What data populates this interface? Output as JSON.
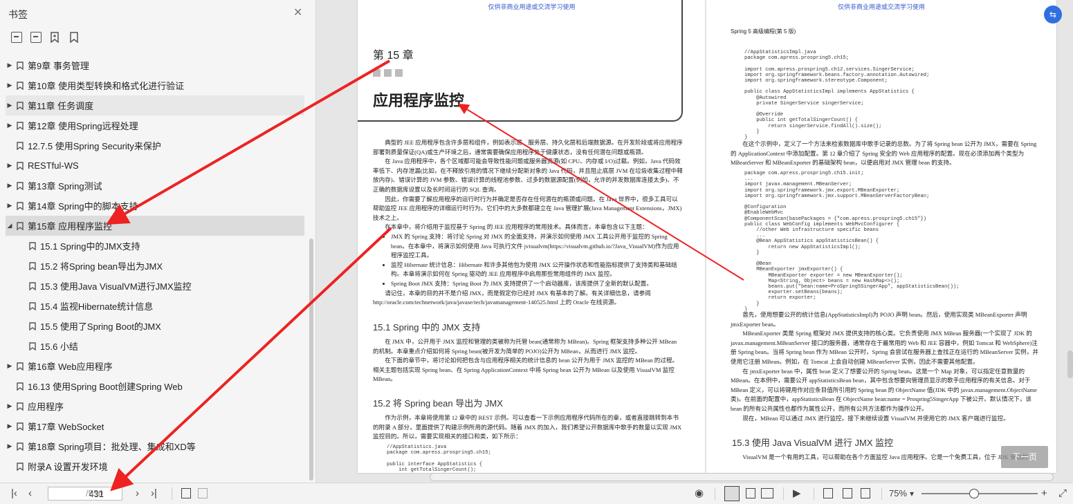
{
  "sidebar": {
    "title": "书签",
    "items": [
      {
        "label": "第9章 事务管理",
        "level": 0,
        "expand": "collapsed"
      },
      {
        "label": "第10章 使用类型转换和格式化进行验证",
        "level": 0,
        "expand": "collapsed"
      },
      {
        "label": "第11章 任务调度",
        "level": 0,
        "expand": "collapsed"
      },
      {
        "label": "第12章 使用Spring远程处理",
        "level": 0,
        "expand": "collapsed"
      },
      {
        "label": "12.7.5 使用Spring Security来保护",
        "level": 0,
        "expand": "none"
      },
      {
        "label": "RESTful-WS",
        "level": 0,
        "expand": "collapsed"
      },
      {
        "label": "第13章 Spring测试",
        "level": 0,
        "expand": "collapsed"
      },
      {
        "label": "第14章 Spring中的脚本支持",
        "level": 0,
        "expand": "collapsed"
      },
      {
        "label": "第15章 应用程序监控",
        "level": 0,
        "expand": "expanded"
      },
      {
        "label": "15.1 Spring中的JMX支持",
        "level": 1,
        "expand": "none"
      },
      {
        "label": "15.2 将Spring bean导出为JMX",
        "level": 1,
        "expand": "none"
      },
      {
        "label": "15.3 使用Java VisualVM进行JMX监控",
        "level": 1,
        "expand": "none"
      },
      {
        "label": "15.4 监视Hibernate统计信息",
        "level": 1,
        "expand": "none"
      },
      {
        "label": "15.5 使用了Spring Boot的JMX",
        "level": 1,
        "expand": "none"
      },
      {
        "label": "15.6 小结",
        "level": 1,
        "expand": "none"
      },
      {
        "label": "第16章 Web应用程序",
        "level": 0,
        "expand": "collapsed"
      },
      {
        "label": "16.13 使用Spring Boot创建Spring Web",
        "level": 0,
        "expand": "none"
      },
      {
        "label": "应用程序",
        "level": 0,
        "expand": "collapsed"
      },
      {
        "label": "第17章 WebSocket",
        "level": 0,
        "expand": "collapsed"
      },
      {
        "label": "第18章 Spring项目：批处理、集成和XD等",
        "level": 0,
        "expand": "collapsed"
      },
      {
        "label": "附录A 设置开发环境",
        "level": 0,
        "expand": "none"
      }
    ]
  },
  "page1": {
    "watermark": "仅供非商业用途或交流学习使用",
    "chapter_no": "第 15 章",
    "chapter_title": "应用程序监控",
    "intro": [
      "典型的 JEE 应用程序包含许多层和组件，例如表示层、服务层、持久化层和后端数据源。在开发阶段或将应用程序部署到质量保证(QA)或生产环境之后，通常需要确保应用程序处于健康状态，没有任何潜在问题或瓶颈。",
      "在 Java 应用程序中，各个区域都可能会导致性能问题或服务器资源(如 CPU、内存或 I/O)过载。例如，Java 代码效率低下、内存泄漏(比如，在不释放引用的情况下继续分配新对象的 Java 代码，并且阻止底层 JVM 在垃圾收集过程中释放内存)、错误计算的 JVM 参数、错误计算的线程池参数、过多的数据源配置(例如，允许的并发数据库连接太多)、不正确的数据库设置以及长时间运行的 SQL 查询。",
      "因此，你需要了解应用程序的运行时行为并确定是否存在任何潜在的瓶颈或问题。在 Java 世界中，很多工具可以帮助监控 JEE 应用程序的详细运行时行为。它们中的大多数都建立在 Java 管理扩展(Java Management Extensions，JMX)技术之上。",
      "在本章中，将介绍用于监控基于 Spring 的 JEE 应用程序的常用技术。具体而言，本章包含以下主题："
    ],
    "bullets": [
      "JMX 的 Spring 支持：将讨论 Spring 对 JMX 的全面支持，并演示如何使用 JMX 工具公开用于监控的 Spring bean。在本章中，将演示如何使用 Java 可执行文件 jvisualvm(https://visualvm.github.io/?Java_VisualVM)作为应用程序监控工具。",
      "监控 Hibernate 统计信息：Hibernate 和许多其他包为使用 JMX 公开操作状态和性能指标提供了支持类和基础结构。本章将演示如何在 Spring 驱动的 JEE 应用程序中启用那些常用组件的 JMX 监控。",
      "Spring Boot JMX 支持：Spring Boot 为 JMX 支持提供了一个启动器库，该库提供了全新的默认配置。"
    ],
    "note": "请记住，本章的目的并不是介绍 JMX，而是假定你已经对 JMX 有基本的了解。有关详细信息，请参阅 http://oracle.com/technetwork/java/javase/tech/javamanagement-140525.html 上的 Oracle 在线资源。",
    "h_15_1": "15.1   Spring 中的 JMX 支持",
    "p_15_1": [
      "在 JMX 中，公开用于 JMX 监控和管理的类被称为托管 bean(通常称为 MBean)。Spring 框架支持多种公开 MBean 的机制。本章重点介绍如何将 Spring bean(被开发为简单的 POJO)公开为 MBean，从而进行 JMX 监控。",
      "在下面的章节中，将讨论如何把包含与应用程序相关的统计信息的 bean 公开为用于 JMX 监控的 MBean 的过程。相关主题包括实现 Spring bean、在 Spring ApplicationContext 中将 Spring bean 公开为 MBean 以及使用 VisualVM 监控 MBean。"
    ],
    "h_15_2": "15.2   将 Spring bean 导出为 JMX",
    "p_15_2": "作为示例，本章将使用第 12 章中的 REST 示例。可以查看一下示例应用程序代码所在的章，或者直接跳转到本书的附录 A 部分，里面提供了构建示例所用的源代码。随着 JMX 的加入，我们希望公开数据库中歌手的数量以实现 JMX 监控目的。所以，需要实现相关的接口和类，如下所示：",
    "code": "//AppStatistics.java\npackage com.apress.prospring5.ch15;\n\npublic interface AppStatistics {\n    int getTotalSingerCount();"
  },
  "page2": {
    "watermark": "仅供非商业用途或交流学习使用",
    "running_head": "Spring 5 高级编程(第 5 版)",
    "code1": "//AppStatisticsImpl.java\npackage com.apress.prospring5.ch15;\n\nimport com.apress.prospring5.ch12.services.SingerService;\nimport org.springframework.beans.factory.annotation.Autowired;\nimport org.springframework.stereotype.Component;\n\npublic class AppStatisticsImpl implements AppStatistics {\n    @Autowired\n    private SingerService singerService;\n\n    @Override\n    public int getTotalSingerCount() {\n        return singerService.findAll().size();\n    }\n}",
    "p1": "在这个示例中，定义了一个方法来检索数据库中歌手记录的总数。为了将 Spring bean 公开为 JMX，需要在 Spring 的 ApplicationContext 中添加配置。第 12 章介绍了 Spring 安全的 Web 应用程序的配置。现在必须添加两个类型为 MBeanServer 和 MBeanExporter 的基础架构 bean，以便启用对 JMX 管理 bean 的支持。",
    "code2": "package com.apress.prospring5.ch15.init;\n...\nimport javax.management.MBeanServer;\nimport org.springframework.jmx.export.MBeanExporter;\nimport org.springframework.jmx.support.MBeanServerFactoryBean;\n\n@Configuration\n@EnableWebMvc\n@ComponentScan(basePackages = {\"com.apress.prospring5.ch15\"})\npublic class WebConfig implements WebMvcConfigurer {\n    //other Web infrastructure specific beans\n    ...\n    @Bean AppStatistics appStatisticsBean() {\n        return new AppStatisticsImpl();\n    }\n\n    @Bean\n    MBeanExporter jmxExporter() {\n        MBeanExporter exporter = new MBeanExporter();\n        Map<String, Object> beans = new HashMap<>();\n        beans.put(\"bean:name=ProSpring5SingerApp\", appStatisticsBean());\n        exporter.setBeans(beans);\n        return exporter;\n    }\n}",
    "paras": [
      "首先，使用想要公开的统计信息(AppStatisticsImpl)为 POJO 声明 bean。然后，使用实现类 MBeanExporter 声明 jmxExporter bean。",
      "MBeanExporter 类是 Spring 框架对 JMX 提供支持的核心类。它负责使用 JMX MBean 服务器(一个实现了 JDK 的 javax.management.MBeanServer 接口的服务器，通常存在于最常用的 Web 和 JEE 容器中，例如 Tomcat 和 WebSphere)注册 Spring bean。当将 Spring bean 作为 MBean 公开时，Spring 会尝试在服务器上查找正在运行的 MBeanServer 实例，并使用它注册 MBean。例如，在 Tomcat 上会自动创建 MBeanServer 实例，因此不需要其他配置。",
      "在 jmxExporter bean 中，属性 bean 定义了想要公开的 Spring bean。这是一个 Map 对象，可以指定任意数量的 MBean。在本例中，需要公开 appStatisticsBean bean，其中包含想要向管理员显示的歌手应用程序的有关信息。对于 MBean 定义，可以将键用作对应条目值所引用的 Spring bean 的 ObjectName 值(JDK 中的 javax.management.ObjectName 类)。在前面的配置中，appStatisticsBean 在 ObjectName bean:name = Prospring5SingerApp 下被公开。默认情况下，该 bean 的所有公共属性也都作为属性公开，而所有公共方法都作为操作公开。",
      "现在，MBean 可以通过 JMX 进行监控。接下来继续设置 VisualVM 并使用它的 JMX 客户端进行监控。"
    ],
    "h_15_3": "15.3   使用 Java VisualVM 进行 JMX 监控",
    "p_15_3": "VisualVM 是一个有用的工具，可以帮助在各个方面监控 Java 应用程序。它是一个免费工具，位于 JDK 安装的"
  },
  "overlay": {
    "next_page_label": "下一页"
  },
  "bottombar": {
    "current_page": "431",
    "total_pages": "/550",
    "zoom": "75%"
  },
  "colors": {
    "arrow": "#ee2222",
    "accent": "#2f6fe0"
  }
}
